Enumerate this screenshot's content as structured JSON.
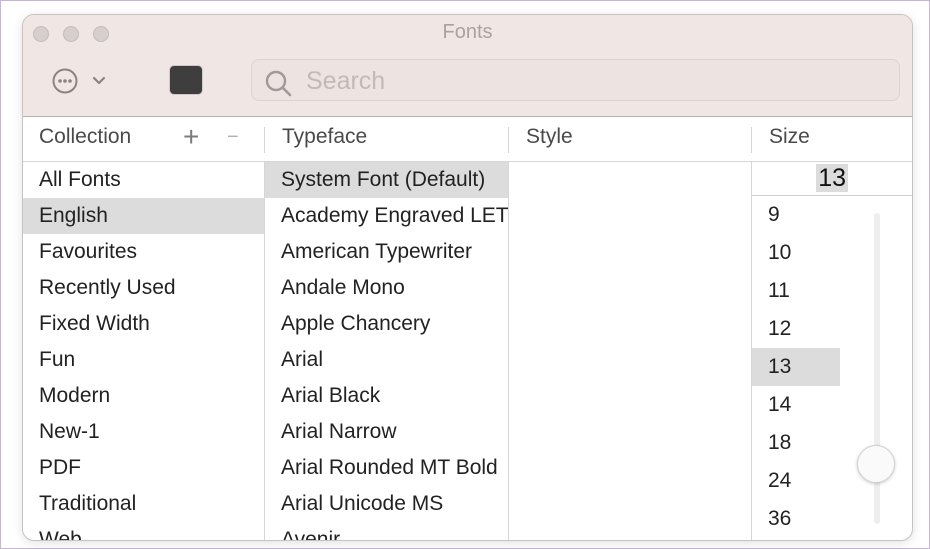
{
  "window": {
    "title": "Fonts"
  },
  "toolbar": {
    "actions_icon": "ellipsis-circle-icon",
    "color_swatch": "#3e3e3e",
    "search_placeholder": "Search"
  },
  "columns": {
    "collection": "Collection",
    "typeface": "Typeface",
    "style": "Style",
    "size": "Size",
    "add": "+",
    "remove": "−"
  },
  "collections": [
    {
      "label": "All Fonts",
      "selected": false
    },
    {
      "label": "English",
      "selected": true
    },
    {
      "label": "Favourites",
      "selected": false
    },
    {
      "label": "Recently Used",
      "selected": false
    },
    {
      "label": "Fixed Width",
      "selected": false
    },
    {
      "label": "Fun",
      "selected": false
    },
    {
      "label": "Modern",
      "selected": false
    },
    {
      "label": "New-1",
      "selected": false
    },
    {
      "label": "PDF",
      "selected": false
    },
    {
      "label": "Traditional",
      "selected": false
    },
    {
      "label": "Web",
      "selected": false
    }
  ],
  "typefaces": [
    {
      "label": "System Font (Default)",
      "selected": true
    },
    {
      "label": "Academy Engraved LET",
      "selected": false
    },
    {
      "label": "American Typewriter",
      "selected": false
    },
    {
      "label": "Andale Mono",
      "selected": false
    },
    {
      "label": "Apple Chancery",
      "selected": false
    },
    {
      "label": "Arial",
      "selected": false
    },
    {
      "label": "Arial Black",
      "selected": false
    },
    {
      "label": "Arial Narrow",
      "selected": false
    },
    {
      "label": "Arial Rounded MT Bold",
      "selected": false
    },
    {
      "label": "Arial Unicode MS",
      "selected": false
    },
    {
      "label": "Avenir",
      "selected": false
    }
  ],
  "size": {
    "current": "13",
    "options": [
      "9",
      "10",
      "11",
      "12",
      "13",
      "14",
      "18",
      "24",
      "36"
    ],
    "selected": "13",
    "slider_fraction": 0.85
  }
}
